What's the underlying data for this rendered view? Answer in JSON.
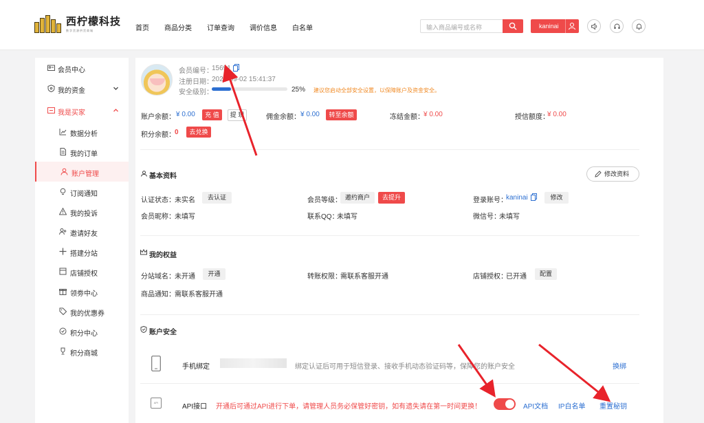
{
  "header": {
    "logo_title": "西柠檬科技",
    "logo_sub": "数字货源供货商城",
    "nav": [
      "首页",
      "商品分类",
      "订单查询",
      "调价信息",
      "白名单"
    ],
    "search_placeholder": "输入商品编号或名称",
    "username": "kaninai"
  },
  "sidebar": {
    "items": [
      {
        "label": "会员中心",
        "icon": "id-card-icon"
      },
      {
        "label": "我的资金",
        "icon": "shield-icon"
      },
      {
        "label": "我是买家",
        "icon": "buyer-icon"
      },
      {
        "label": "数据分析",
        "icon": "chart-icon"
      },
      {
        "label": "我的订单",
        "icon": "document-icon"
      },
      {
        "label": "账户管理",
        "icon": "user-icon"
      },
      {
        "label": "订阅通知",
        "icon": "bulb-icon"
      },
      {
        "label": "我的投诉",
        "icon": "warning-icon"
      },
      {
        "label": "邀请好友",
        "icon": "invite-icon"
      },
      {
        "label": "搭建分站",
        "icon": "plus-icon"
      },
      {
        "label": "店铺授权",
        "icon": "shop-icon"
      },
      {
        "label": "领劵中心",
        "icon": "gift-icon"
      },
      {
        "label": "我的优惠券",
        "icon": "tag-icon"
      },
      {
        "label": "积分中心",
        "icon": "points-icon"
      },
      {
        "label": "积分商城",
        "icon": "trophy-icon"
      }
    ]
  },
  "profile": {
    "member_id_label": "会员编号：",
    "member_id": "15691",
    "reg_date_label": "注册日期：",
    "reg_date": "2022-09-02 15:41:37",
    "security_label": "安全级别：",
    "security_percent": "25%",
    "security_level": 0.25,
    "security_tip": "建议您启动全部安全设置，以保障账户及资金安全。"
  },
  "balances": {
    "account_label": "账户余额：",
    "account_value": "¥ 0.00",
    "recharge": "充 值",
    "withdraw": "提 现",
    "commission_label": "佣金余额：",
    "commission_value": "¥ 0.00",
    "transfer": "转至余额",
    "frozen_label": "冻结金额：",
    "frozen_value": "¥ 0.00",
    "credit_label": "授信额度：",
    "credit_value": "¥ 0.00",
    "points_label": "积分余额：",
    "points_value": "0",
    "exchange": "去兑换"
  },
  "basic": {
    "title": "基本资料",
    "edit": "修改资料",
    "auth_label": "认证状态：",
    "auth_value": "未实名",
    "auth_btn": "去认证",
    "level_label": "会员等级：",
    "level_value": "邀约商户",
    "level_btn": "去提升",
    "account_label": "登录账号：",
    "account_value": "kaninai",
    "account_btn": "修改",
    "nickname_label": "会员昵称：",
    "nickname_value": "未填写",
    "qq_label": "联系QQ：",
    "qq_value": "未填写",
    "wechat_label": "微信号：",
    "wechat_value": "未填写"
  },
  "rights": {
    "title": "我的权益",
    "domain_label": "分站域名：",
    "domain_value": "未开通",
    "domain_btn": "开通",
    "transfer_label": "转账权限：",
    "transfer_value": "需联系客服开通",
    "shop_label": "店铺授权：",
    "shop_value": "已开通",
    "shop_btn": "配置",
    "notice_label": "商品通知：",
    "notice_value": "需联系客服开通"
  },
  "security": {
    "title": "账户安全",
    "phone_title": "手机绑定",
    "phone_desc": "绑定认证后可用于短信登录、接收手机动态验证码等，保障您的账户安全",
    "phone_action": "换绑",
    "api_title": "API接口",
    "api_desc": "开通后可通过API进行下单，请管理人员务必保管好密钥，如有遗失请在第一时间更换！",
    "api_icon_text": "API",
    "api_doc": "API文档",
    "ip_whitelist": "IP白名单",
    "reset_key": "重置秘钥"
  },
  "colors": {
    "accent": "#ef4a4a",
    "link": "#2c6fd1"
  }
}
